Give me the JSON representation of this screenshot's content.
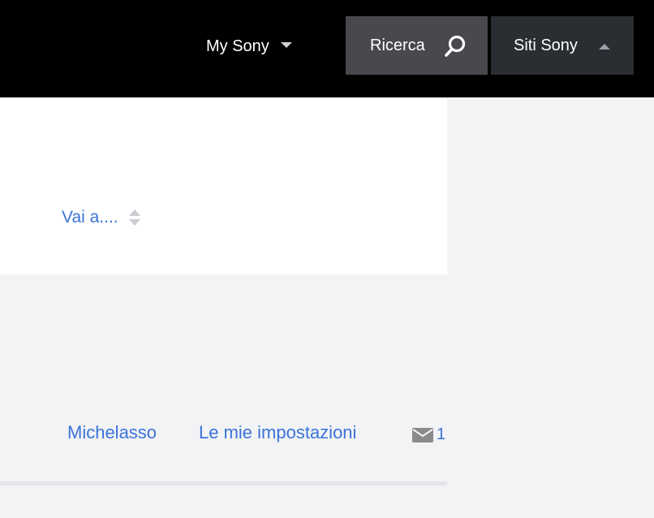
{
  "header": {
    "my_sony_label": "My Sony",
    "search_label": "Ricerca",
    "sites_label": "Siti Sony"
  },
  "nav": {
    "jump_label": "Vai a...."
  },
  "user": {
    "username": "Michelasso",
    "settings_label": "Le mie impostazioni",
    "message_count": "1"
  },
  "colors": {
    "link": "#3b73d9",
    "topbar": "#000000",
    "search_bg": "#4b474e",
    "sites_bg": "#2a2e33",
    "page_bg": "#f2f3f5"
  }
}
